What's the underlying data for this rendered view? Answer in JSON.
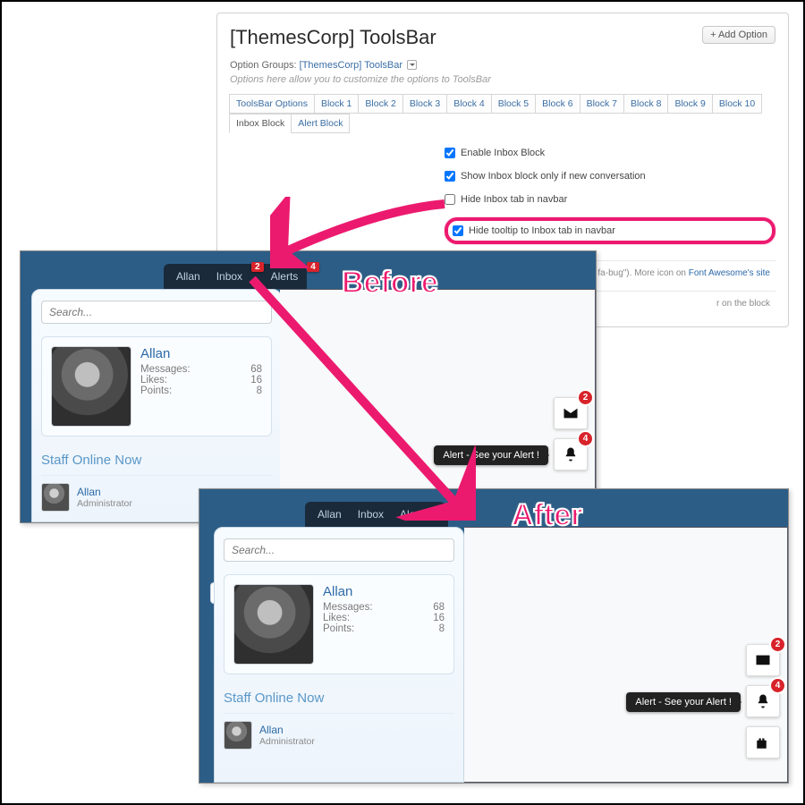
{
  "admin": {
    "title": "[ThemesCorp] ToolsBar",
    "add_option_label": "+ Add Option",
    "option_groups_label": "Option Groups:",
    "option_groups_link": "[ThemesCorp] ToolsBar",
    "desc": "Options here allow you to customize the options to ToolsBar",
    "tabs": [
      "ToolsBar Options",
      "Block 1",
      "Block 2",
      "Block 3",
      "Block 4",
      "Block 5",
      "Block 6",
      "Block 7",
      "Block 8",
      "Block 9",
      "Block 10",
      "Inbox Block",
      "Alert Block"
    ],
    "active_tab_index": 11,
    "options": [
      {
        "checked": true,
        "label": "Enable Inbox Block"
      },
      {
        "checked": true,
        "label": "Show Inbox block only if new conversation"
      },
      {
        "checked": false,
        "label": "Hide Inbox tab in navbar"
      },
      {
        "checked": true,
        "label": "Hide tooltip to Inbox tab in navbar"
      }
    ],
    "hint1_prefix": "ample: \"fa fa-bug\"). More icon on ",
    "hint1_link": "Font Awesome's site",
    "hint2": "r on the block"
  },
  "labels": {
    "before": "Before",
    "after": "After"
  },
  "forum": {
    "nav": {
      "user": "Allan",
      "inbox": "Inbox",
      "alerts": "Alerts",
      "inbox_badge": "2",
      "alerts_badge": "4"
    },
    "search_placeholder": "Search...",
    "user_card": {
      "name": "Allan",
      "stats": [
        {
          "label": "Messages:",
          "value": "68"
        },
        {
          "label": "Likes:",
          "value": "16"
        },
        {
          "label": "Points:",
          "value": "8"
        }
      ]
    },
    "staff_heading": "Staff Online Now",
    "staff": [
      {
        "name": "Allan",
        "role": "Administrator"
      }
    ],
    "fab_inbox_badge": "2",
    "fab_alert_badge": "4",
    "alert_tooltip": "Alert - See your Alert !"
  }
}
